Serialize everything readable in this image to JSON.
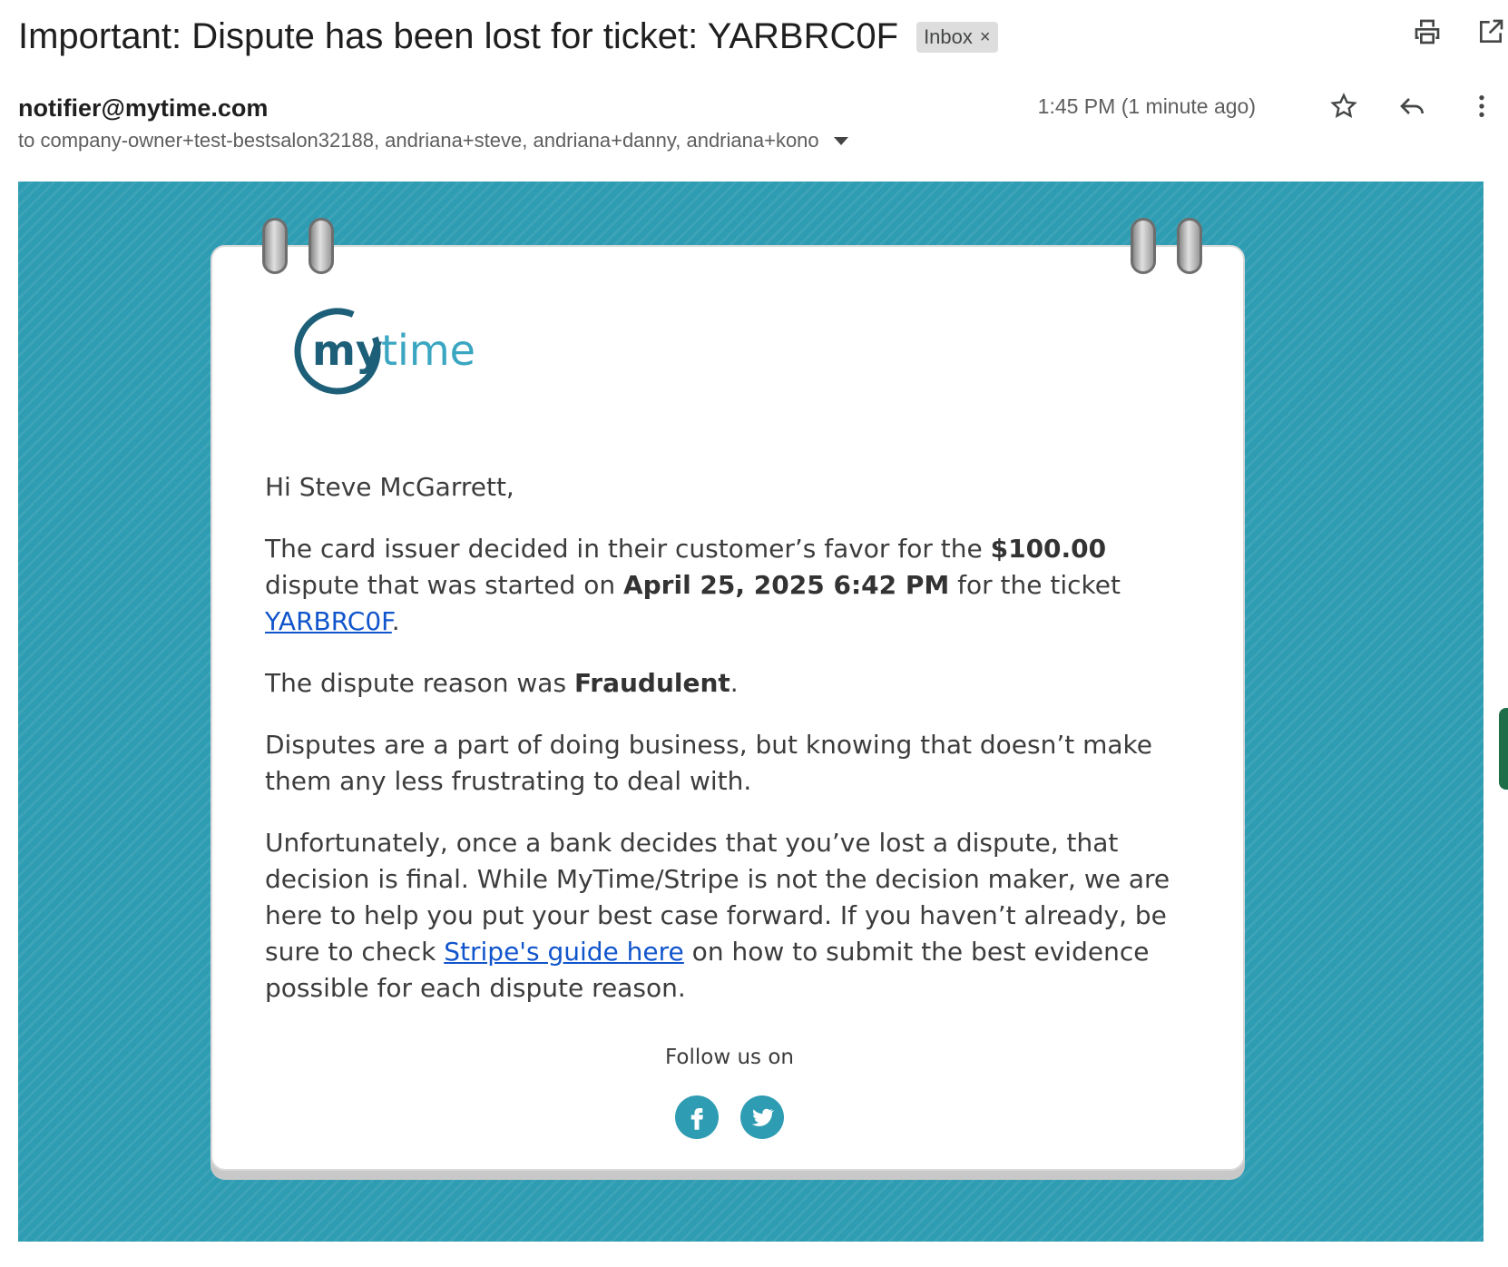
{
  "header": {
    "subject": "Important: Dispute has been lost for ticket: YARBRC0F",
    "label": "Inbox",
    "label_close": "×"
  },
  "sender": {
    "email": "notifier@mytime.com",
    "timestamp": "1:45 PM (1 minute ago)",
    "recipients": "to company-owner+test-bestsalon32188, andriana+steve, andriana+danny, andriana+kono"
  },
  "icons": [
    "print-icon",
    "open-in-new-window-icon",
    "star-icon",
    "reply-icon",
    "more-vert-icon",
    "chevron-down-icon",
    "facebook-icon",
    "twitter-icon"
  ],
  "colors": {
    "background": "#2e9cb2",
    "link": "#1155cc",
    "logo_dark": "#1d5f78",
    "logo_light": "#3aa6c2"
  },
  "logo": {
    "text_my": "my",
    "text_time": "time"
  },
  "body": {
    "greeting": "Hi Steve McGarrett,",
    "p1_a": "The card issuer decided in their customer’s favor for the ",
    "p1_amount": "$100.00",
    "p1_b": " dispute that was started on ",
    "p1_date": "April 25, 2025 6:42 PM",
    "p1_c": " for the ticket ",
    "p1_ticket": "YARBRC0F",
    "p1_end": ".",
    "p2_a": "The dispute reason was ",
    "p2_reason": "Fraudulent",
    "p2_end": ".",
    "p3": "Disputes are a part of doing business, but knowing that doesn’t make them any less frustrating to deal with.",
    "p4_a": "Unfortunately, once a bank decides that you’ve lost a dispute, that decision is final. While MyTime/Stripe is not the decision maker, we are here to help you put your best case forward. If you haven’t already, be sure to check ",
    "p4_link": "Stripe's guide here",
    "p4_b": " on how to submit the best evidence possible for each dispute reason."
  },
  "footer": {
    "follow": "Follow us on"
  }
}
